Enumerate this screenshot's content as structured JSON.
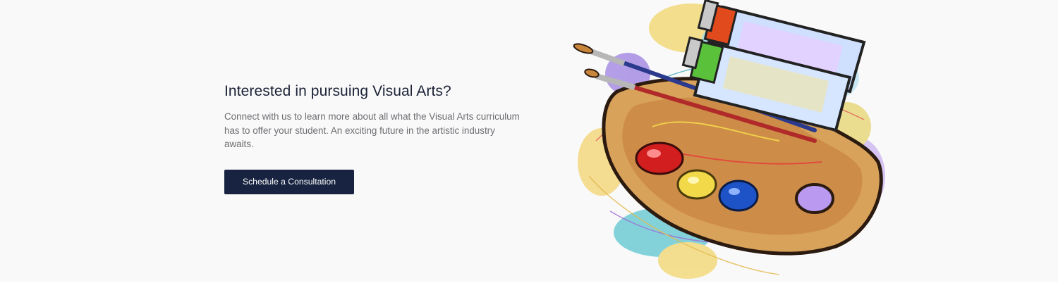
{
  "cta_section": {
    "heading": "Interested in pursuing Visual Arts?",
    "description": "Connect with us to learn more about all what the Visual Arts curriculum has to offer your student. An exciting future in the artistic industry awaits.",
    "button_label": "Schedule a Consultation"
  },
  "colors": {
    "background": "#f9f9f9",
    "heading": "#1b2236",
    "body_text": "#6d6d72",
    "button_bg": "#172340",
    "button_text": "#ffffff"
  },
  "illustration": {
    "icon": "paint-palette-illustration"
  }
}
